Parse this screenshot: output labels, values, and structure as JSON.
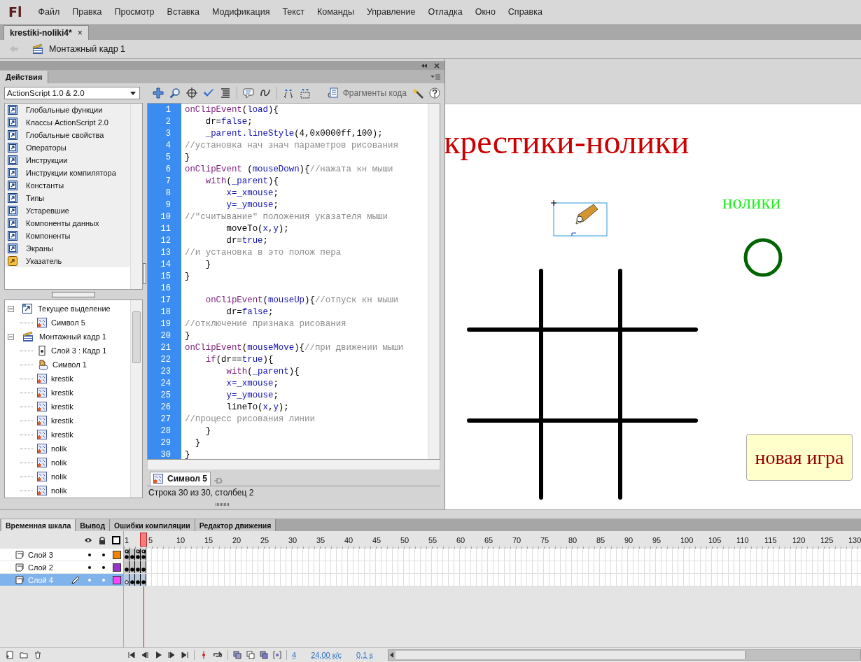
{
  "app": {
    "logo": "Fl"
  },
  "menu": [
    "Файл",
    "Правка",
    "Просмотр",
    "Вставка",
    "Модификация",
    "Текст",
    "Команды",
    "Управление",
    "Отладка",
    "Окно",
    "Справка"
  ],
  "document_tabs": [
    {
      "label": "krestiki-noliki4*",
      "close": "×",
      "selected": true
    }
  ],
  "breadcrumb": {
    "label": "Монтажный кадр 1"
  },
  "actions_panel": {
    "tab": "Действия",
    "version_dropdown": "ActionScript 1.0 & 2.0",
    "code_snippets_button": "Фрагменты кода",
    "categories": [
      {
        "label": "Глобальные функции",
        "kind": "book"
      },
      {
        "label": "Классы ActionScript 2.0",
        "kind": "book"
      },
      {
        "label": "Глобальные свойства",
        "kind": "book"
      },
      {
        "label": "Операторы",
        "kind": "book"
      },
      {
        "label": "Инструкции",
        "kind": "book"
      },
      {
        "label": "Инструкции компилятора",
        "kind": "book"
      },
      {
        "label": "Константы",
        "kind": "book"
      },
      {
        "label": "Типы",
        "kind": "book"
      },
      {
        "label": "Устаревшие",
        "kind": "book"
      },
      {
        "label": "Компоненты данных",
        "kind": "book"
      },
      {
        "label": "Компоненты",
        "kind": "book"
      },
      {
        "label": "Экраны",
        "kind": "book"
      },
      {
        "label": "Указатель",
        "kind": "index"
      }
    ],
    "tree": [
      {
        "label": "Текущее выделение",
        "kind": "selection",
        "expanded": true,
        "children": [
          {
            "label": "Символ 5",
            "kind": "movieclip"
          }
        ]
      },
      {
        "label": "Монтажный кадр 1",
        "kind": "scene",
        "expanded": true,
        "children": [
          {
            "label": "Слой 3 : Кадр 1",
            "kind": "frame"
          },
          {
            "label": "Символ 1",
            "kind": "button"
          },
          {
            "label": "krestik",
            "kind": "movieclip"
          },
          {
            "label": "krestik",
            "kind": "movieclip"
          },
          {
            "label": "krestik",
            "kind": "movieclip"
          },
          {
            "label": "krestik",
            "kind": "movieclip"
          },
          {
            "label": "krestik",
            "kind": "movieclip"
          },
          {
            "label": "nolik",
            "kind": "movieclip"
          },
          {
            "label": "nolik",
            "kind": "movieclip"
          },
          {
            "label": "nolik",
            "kind": "movieclip"
          },
          {
            "label": "nolik",
            "kind": "movieclip"
          }
        ]
      }
    ],
    "code_lines": [
      {
        "number": "1",
        "tokens": [
          {
            "kind": "keyword",
            "text": "onClipEvent"
          },
          {
            "kind": "plain",
            "text": "("
          },
          {
            "kind": "identifier",
            "text": "load"
          },
          {
            "kind": "plain",
            "text": "){"
          }
        ]
      },
      {
        "number": "2",
        "tokens": [
          {
            "kind": "plain",
            "text": "    dr="
          },
          {
            "kind": "identifier",
            "text": "false"
          },
          {
            "kind": "plain",
            "text": ";"
          }
        ]
      },
      {
        "number": "3",
        "tokens": [
          {
            "kind": "identifier",
            "text": "    _parent.lineStyle"
          },
          {
            "kind": "plain",
            "text": "(4,0x0000ff,100);"
          }
        ]
      },
      {
        "number": "4",
        "tokens": [
          {
            "kind": "comment",
            "text": "//установка нач знач параметров рисования"
          }
        ]
      },
      {
        "number": "5",
        "tokens": [
          {
            "kind": "plain",
            "text": "}"
          }
        ]
      },
      {
        "number": "6",
        "tokens": [
          {
            "kind": "keyword",
            "text": "onClipEvent"
          },
          {
            "kind": "plain",
            "text": " ("
          },
          {
            "kind": "identifier",
            "text": "mouseDown"
          },
          {
            "kind": "plain",
            "text": "){"
          },
          {
            "kind": "comment",
            "text": "//нажата кн мыши"
          }
        ]
      },
      {
        "number": "7",
        "tokens": [
          {
            "kind": "keyword",
            "text": "    with"
          },
          {
            "kind": "plain",
            "text": "("
          },
          {
            "kind": "identifier",
            "text": "_parent"
          },
          {
            "kind": "plain",
            "text": "){"
          }
        ]
      },
      {
        "number": "8",
        "tokens": [
          {
            "kind": "identifier",
            "text": "        x=_xmouse"
          },
          {
            "kind": "plain",
            "text": ";"
          }
        ]
      },
      {
        "number": "9",
        "tokens": [
          {
            "kind": "identifier",
            "text": "        y=_ymouse"
          },
          {
            "kind": "plain",
            "text": ";"
          }
        ]
      },
      {
        "number": "10",
        "tokens": [
          {
            "kind": "comment",
            "text": "//\"считывание\" положения указателя мыши"
          }
        ]
      },
      {
        "number": "11",
        "tokens": [
          {
            "kind": "plain",
            "text": "        moveTo("
          },
          {
            "kind": "identifier",
            "text": "x"
          },
          {
            "kind": "plain",
            "text": ","
          },
          {
            "kind": "identifier",
            "text": "y"
          },
          {
            "kind": "plain",
            "text": ");"
          }
        ]
      },
      {
        "number": "12",
        "tokens": [
          {
            "kind": "plain",
            "text": "        dr="
          },
          {
            "kind": "identifier",
            "text": "true"
          },
          {
            "kind": "plain",
            "text": ";"
          }
        ]
      },
      {
        "number": "13",
        "tokens": [
          {
            "kind": "comment",
            "text": "//и установка в это полож пера"
          }
        ]
      },
      {
        "number": "14",
        "tokens": [
          {
            "kind": "plain",
            "text": "    }"
          }
        ]
      },
      {
        "number": "15",
        "tokens": [
          {
            "kind": "plain",
            "text": "}"
          }
        ]
      },
      {
        "number": "16"
      },
      {
        "number": "17",
        "tokens": [
          {
            "kind": "keyword",
            "text": "    onClipEvent"
          },
          {
            "kind": "plain",
            "text": "("
          },
          {
            "kind": "identifier",
            "text": "mouseUp"
          },
          {
            "kind": "plain",
            "text": "){"
          },
          {
            "kind": "comment",
            "text": "//отпуск кн мыши"
          }
        ]
      },
      {
        "number": "18",
        "tokens": [
          {
            "kind": "plain",
            "text": "        dr="
          },
          {
            "kind": "identifier",
            "text": "false"
          },
          {
            "kind": "plain",
            "text": ";"
          }
        ]
      },
      {
        "number": "19",
        "tokens": [
          {
            "kind": "comment",
            "text": "//отключение признака рисования"
          }
        ]
      },
      {
        "number": "20",
        "tokens": [
          {
            "kind": "plain",
            "text": "}"
          }
        ]
      },
      {
        "number": "21",
        "tokens": [
          {
            "kind": "keyword",
            "text": "onClipEvent"
          },
          {
            "kind": "plain",
            "text": "("
          },
          {
            "kind": "identifier",
            "text": "mouseMove"
          },
          {
            "kind": "plain",
            "text": "){"
          },
          {
            "kind": "comment",
            "text": "//при движении мыши"
          }
        ]
      },
      {
        "number": "22",
        "tokens": [
          {
            "kind": "keyword",
            "text": "    if"
          },
          {
            "kind": "plain",
            "text": "(dr=="
          },
          {
            "kind": "identifier",
            "text": "true"
          },
          {
            "kind": "plain",
            "text": "){"
          }
        ]
      },
      {
        "number": "23",
        "tokens": [
          {
            "kind": "keyword",
            "text": "        with"
          },
          {
            "kind": "plain",
            "text": "("
          },
          {
            "kind": "identifier",
            "text": "_parent"
          },
          {
            "kind": "plain",
            "text": "){"
          }
        ]
      },
      {
        "number": "24",
        "tokens": [
          {
            "kind": "identifier",
            "text": "        x=_xmouse"
          },
          {
            "kind": "plain",
            "text": ";"
          }
        ]
      },
      {
        "number": "25",
        "tokens": [
          {
            "kind": "identifier",
            "text": "        y=_ymouse"
          },
          {
            "kind": "plain",
            "text": ";"
          }
        ]
      },
      {
        "number": "26",
        "tokens": [
          {
            "kind": "plain",
            "text": "        lineTo("
          },
          {
            "kind": "identifier",
            "text": "x"
          },
          {
            "kind": "plain",
            "text": ","
          },
          {
            "kind": "identifier",
            "text": "y"
          },
          {
            "kind": "plain",
            "text": ");"
          }
        ]
      },
      {
        "number": "27",
        "tokens": [
          {
            "kind": "comment",
            "text": "//процесс рисования линии"
          }
        ]
      },
      {
        "number": "28",
        "tokens": [
          {
            "kind": "plain",
            "text": "    }"
          }
        ]
      },
      {
        "number": "29",
        "tokens": [
          {
            "kind": "plain",
            "text": "  }"
          }
        ]
      },
      {
        "number": "30",
        "tokens": [
          {
            "kind": "plain",
            "text": "}"
          }
        ]
      }
    ],
    "script_tab": {
      "label": "Символ 5"
    },
    "status": "Строка 30 из 30, столбец 2"
  },
  "stage": {
    "title": "крестики-нолики",
    "label": "нолики",
    "new_game_button": "новая игра"
  },
  "timeline": {
    "tabs": [
      {
        "label": "Временная шкала",
        "selected": true
      },
      {
        "label": "Вывод",
        "selected": false
      },
      {
        "label": "Ошибки компиляции",
        "selected": false
      },
      {
        "label": "Редактор движения",
        "selected": false
      }
    ],
    "ruler": [
      "1",
      "5",
      "10",
      "15",
      "20",
      "25",
      "30",
      "35",
      "40",
      "45",
      "50",
      "55",
      "60",
      "65",
      "70",
      "75",
      "80",
      "85",
      "90",
      "95",
      "100",
      "105",
      "110",
      "115",
      "120",
      "125",
      "130"
    ],
    "layers": [
      {
        "name": "Слой 3",
        "selected": false,
        "color": "#f08400",
        "frames": [
          {
            "kind": "keyframe",
            "action": true
          },
          {
            "kind": "keyframe",
            "action": false
          },
          {
            "kind": "keyframe",
            "action": true
          },
          {
            "kind": "keyframe",
            "action": true
          }
        ]
      },
      {
        "name": "Слой 2",
        "selected": false,
        "color": "#9933cc",
        "frames": [
          {
            "kind": "keyframe",
            "action": false
          },
          {
            "kind": "keyframe",
            "action": false
          },
          {
            "kind": "keyframe",
            "action": false
          },
          {
            "kind": "keyframe",
            "action": false
          }
        ]
      },
      {
        "name": "Слой 4",
        "selected": true,
        "color": "#ff44ff",
        "frames": [
          {
            "kind": "empty_keyframe",
            "action": false
          },
          {
            "kind": "keyframe",
            "action": false
          },
          {
            "kind": "keyframe",
            "action": false
          },
          {
            "kind": "keyframe",
            "action": false
          }
        ]
      }
    ],
    "current_frame": "4",
    "frame_rate": "24,00 к/с",
    "time": "0,1 s"
  }
}
